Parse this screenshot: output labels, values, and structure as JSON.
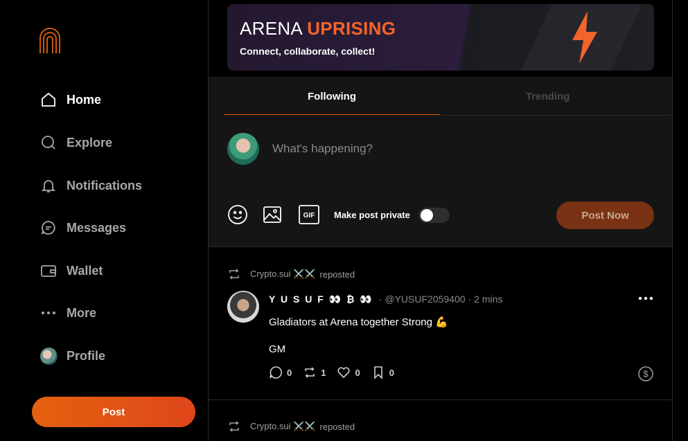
{
  "sidebar": {
    "items": [
      {
        "label": "Home",
        "icon": "home-icon"
      },
      {
        "label": "Explore",
        "icon": "search-icon"
      },
      {
        "label": "Notifications",
        "icon": "bell-icon"
      },
      {
        "label": "Messages",
        "icon": "message-icon"
      },
      {
        "label": "Wallet",
        "icon": "wallet-icon"
      },
      {
        "label": "More",
        "icon": "more-dots-icon"
      },
      {
        "label": "Profile",
        "icon": "avatar"
      }
    ],
    "post_button": "Post"
  },
  "banner": {
    "title_main": "ARENA",
    "title_accent": "UPRISING",
    "subtitle": "Connect, collaborate, collect!"
  },
  "tabs": [
    {
      "label": "Following",
      "active": true
    },
    {
      "label": "Trending",
      "active": false
    }
  ],
  "composer": {
    "placeholder": "What's happening?",
    "private_label": "Make post private",
    "private_enabled": false,
    "submit_label": "Post Now",
    "tools": [
      "emoji-icon",
      "image-icon",
      "gif-icon"
    ]
  },
  "feed": {
    "posts": [
      {
        "repost_by": "Crypto.sui ⚔️⚔️",
        "repost_text": "reposted",
        "author": "Y U S U F 👀 ₿ 👀",
        "handle": "@YUSUF2059400",
        "separator": "·",
        "time": "2 mins",
        "lines": [
          "Gladiators at Arena together Strong 💪",
          "GM"
        ],
        "comments": "0",
        "reposts": "1",
        "likes": "0",
        "bookmarks": "0"
      }
    ],
    "next_repost_by": "Crypto.sui ⚔️⚔️",
    "next_repost_text": "reposted"
  },
  "colors": {
    "accent": "#e3620f",
    "background": "#000000",
    "panel": "#151515",
    "muted_text": "#a8a8a8"
  }
}
